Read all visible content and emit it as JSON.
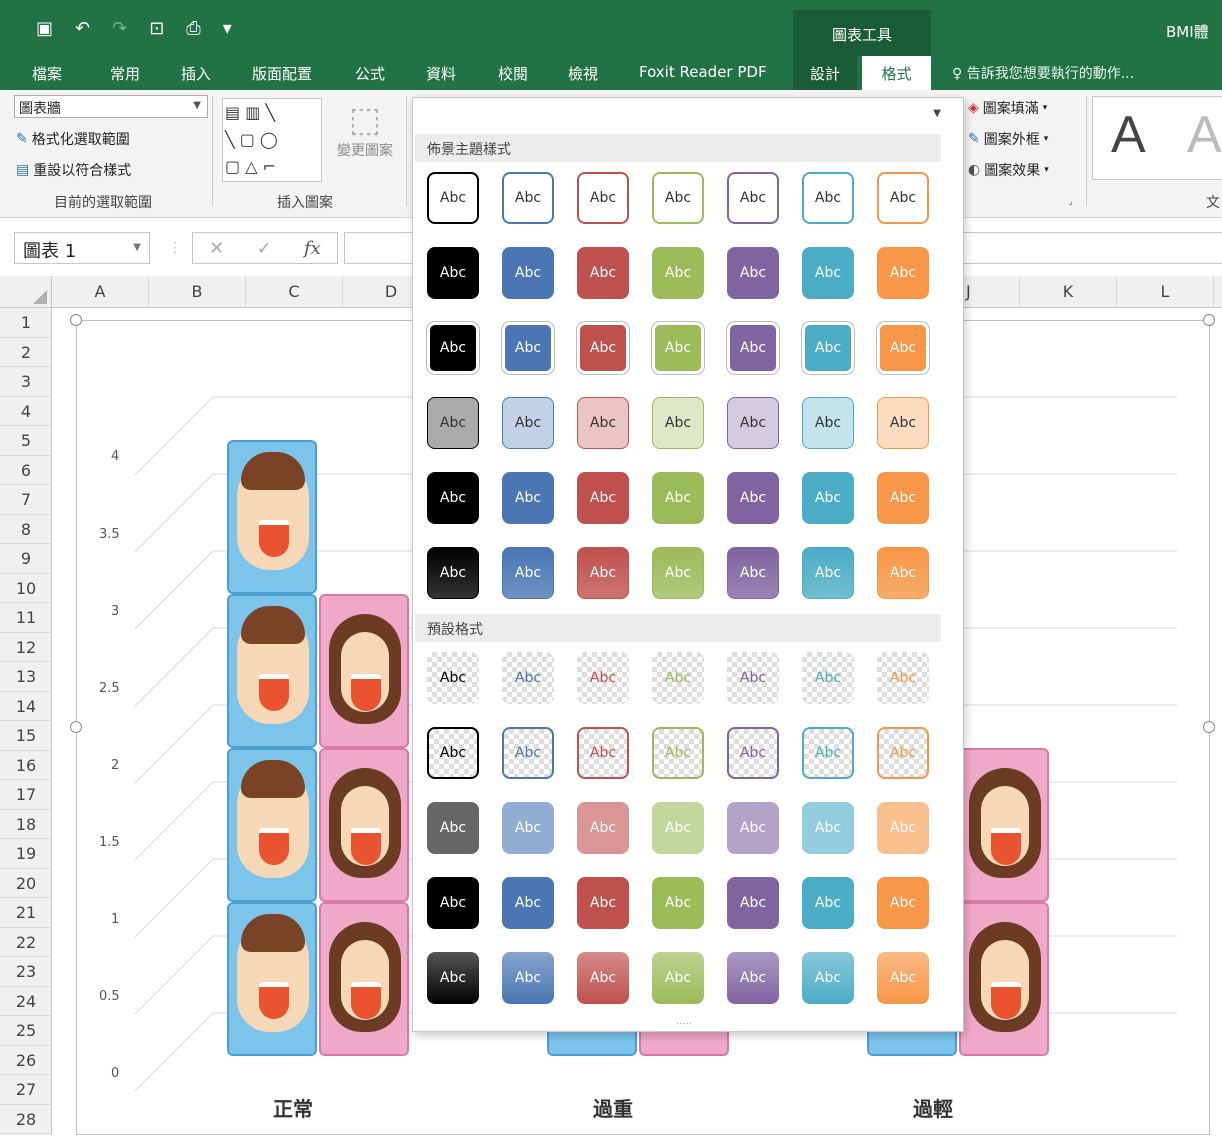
{
  "qat": {
    "save_icon": "save-icon",
    "undo_icon": "undo-icon",
    "redo_icon": "redo-icon",
    "saveas_icon": "saveas-icon",
    "preview_icon": "print-preview-icon",
    "customize": "▾"
  },
  "context_header": "圖表工具",
  "app_title": "BMI體",
  "tabs": [
    "檔案",
    "常用",
    "插入",
    "版面配置",
    "公式",
    "資料",
    "校閱",
    "檢視",
    "Foxit Reader PDF",
    "設計",
    "格式"
  ],
  "tell_me": "告訴我您想要執行的動作...",
  "ribbon": {
    "selection_combo": "圖表牆",
    "format_selection": "格式化選取範圍",
    "reset_style": "重設以符合樣式",
    "group1_label": "目前的選取範圍",
    "change_shape": "變更圖案",
    "group2_label": "插入圖案",
    "shape_fill": "圖案填滿",
    "shape_outline": "圖案外框",
    "shape_effects": "圖案效果",
    "wordart_a1": "A",
    "wordart_a2": "A",
    "text_frag": "文"
  },
  "formula_bar": {
    "name_box": "圖表 1",
    "cancel": "✕",
    "enter": "✓",
    "fx": "fx"
  },
  "columns": [
    "A",
    "B",
    "C",
    "D",
    "J",
    "K",
    "L"
  ],
  "rows": [
    "1",
    "2",
    "3",
    "4",
    "5",
    "6",
    "7",
    "8",
    "9",
    "10",
    "11",
    "12",
    "13",
    "14",
    "15",
    "16",
    "17",
    "18",
    "19",
    "20",
    "21",
    "22",
    "23",
    "24",
    "25",
    "26",
    "27",
    "28"
  ],
  "gallery": {
    "section1": "佈景主題樣式",
    "section2": "預設格式",
    "swatch_label": "Abc",
    "colors": [
      "#000000",
      "#4a76b4",
      "#c0504d",
      "#9bbb59",
      "#8064a2",
      "#4bacc6",
      "#f79646"
    ],
    "more": "....."
  },
  "chart_data": {
    "type": "bar",
    "categories": [
      "正常",
      "過重",
      "過輕"
    ],
    "series": [
      {
        "values": [
          4,
          0.3,
          1
        ]
      },
      {
        "values": [
          3,
          0.3,
          2
        ]
      }
    ],
    "yticks": [
      "4",
      "3.5",
      "3",
      "2.5",
      "2",
      "1.5",
      "1",
      "0.5",
      "0"
    ],
    "ylim": [
      0,
      4
    ]
  }
}
